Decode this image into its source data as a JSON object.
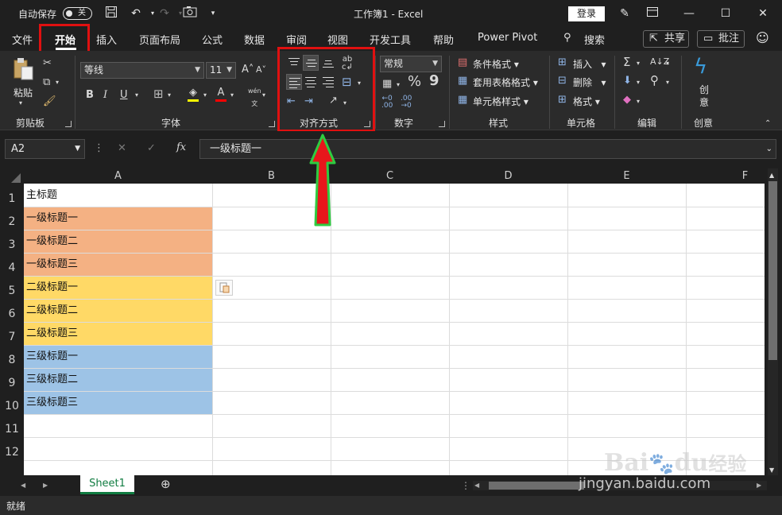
{
  "titlebar": {
    "autosave_label": "自动保存",
    "autosave_state": "关",
    "title": "工作簿1  -  Excel",
    "login_label": "登录"
  },
  "tabs": {
    "items": [
      "文件",
      "开始",
      "插入",
      "页面布局",
      "公式",
      "数据",
      "审阅",
      "视图",
      "开发工具",
      "帮助",
      "Power Pivot"
    ],
    "active": "开始",
    "search_label": "搜索",
    "share_label": "共享",
    "comment_label": "批注"
  },
  "ribbon": {
    "clipboard": {
      "paste_label": "粘贴",
      "group_label": "剪贴板"
    },
    "font": {
      "font_name": "等线",
      "font_size": "11",
      "group_label": "字体",
      "inc": "A",
      "dec": "A",
      "bold": "B",
      "italic": "I",
      "underline": "U",
      "font_color": "A",
      "phonetic": "wén"
    },
    "alignment": {
      "group_label": "对齐方式"
    },
    "number": {
      "format": "常规",
      "group_label": "数字",
      "percent": "%",
      "comma": "9"
    },
    "styles": {
      "conditional": "条件格式",
      "table": "套用表格格式",
      "cell_styles": "单元格样式",
      "group_label": "样式"
    },
    "cells": {
      "insert": "插入",
      "delete": "删除",
      "format": "格式",
      "group_label": "单元格"
    },
    "editing": {
      "group_label": "编辑"
    },
    "creative": {
      "label1": "创",
      "label2": "意",
      "group_label": "创意"
    }
  },
  "formula_bar": {
    "name_box": "A2",
    "formula_value": "一级标题一",
    "fx": "fx"
  },
  "grid": {
    "columns": [
      "A",
      "B",
      "C",
      "D",
      "E",
      "F"
    ],
    "rows": [
      "1",
      "2",
      "3",
      "4",
      "5",
      "6",
      "7",
      "8",
      "9",
      "10",
      "11",
      "12"
    ],
    "cells": [
      {
        "row": 1,
        "text": "主标题",
        "fill": "#ffffff"
      },
      {
        "row": 2,
        "text": "一级标题一",
        "fill": "#f4b183"
      },
      {
        "row": 3,
        "text": "一级标题二",
        "fill": "#f4b183"
      },
      {
        "row": 4,
        "text": "一级标题三",
        "fill": "#f4b183"
      },
      {
        "row": 5,
        "text": "二级标题一",
        "fill": "#ffd966"
      },
      {
        "row": 6,
        "text": "二级标题二",
        "fill": "#ffd966"
      },
      {
        "row": 7,
        "text": "二级标题三",
        "fill": "#ffd966"
      },
      {
        "row": 8,
        "text": "三级标题一",
        "fill": "#9dc3e6"
      },
      {
        "row": 9,
        "text": "三级标题二",
        "fill": "#9dc3e6"
      },
      {
        "row": 10,
        "text": "三级标题三",
        "fill": "#9dc3e6"
      }
    ]
  },
  "sheets": {
    "active": "Sheet1"
  },
  "status": {
    "text": "就绪"
  },
  "watermark": {
    "brand": "Bai",
    "brand2": "du",
    "brand3": "经验",
    "url": "jingyan.baidu.com"
  },
  "colors": {
    "highlight": "#e01010",
    "arrow": "#e8161b",
    "arrow_outline": "#2ecc40",
    "accent": "#107c41"
  }
}
